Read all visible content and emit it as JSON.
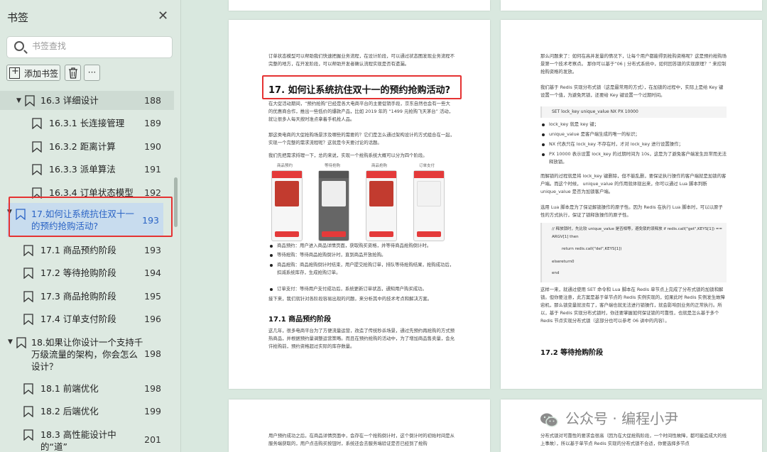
{
  "sidebar": {
    "title": "书签",
    "search_placeholder": "书签查找",
    "add_bookmark_label": "添加书签",
    "more_label": "···",
    "items": [
      {
        "title": "16.3 详细设计",
        "page": "188"
      },
      {
        "title": "16.3.1 长连接管理",
        "page": "189"
      },
      {
        "title": "16.3.2 距离计算",
        "page": "190"
      },
      {
        "title": "16.3.3 派单算法",
        "page": "191"
      },
      {
        "title": "16.3.4 订单状态模型",
        "page": "192"
      },
      {
        "title": "17.如何让系统抗住双十一的预约抢购活动?",
        "page": "193"
      },
      {
        "title": "17.1 商品预约阶段",
        "page": "193"
      },
      {
        "title": "17.2 等待抢购阶段",
        "page": "194"
      },
      {
        "title": "17.3 商品抢购阶段",
        "page": "195"
      },
      {
        "title": "17.4 订单支付阶段",
        "page": "196"
      },
      {
        "title": "18.如果让你设计一个支持千万级流量的架构，你会怎么设计？",
        "page": "198"
      },
      {
        "title": "18.1 前端优化",
        "page": "198"
      },
      {
        "title": "18.2 后端优化",
        "page": "199"
      },
      {
        "title": "18.3 高性能设计中的“道”",
        "page": "201"
      }
    ]
  },
  "doc": {
    "left_heading": "17. 如何让系统抗住双十一的预约抢购活动?",
    "left_sub_heading": "17.1 商品预约阶段",
    "right_sub_heading": "17.2 等待抢购阶段",
    "left_intro": "订单状态模型可以帮助我们快速把握业务流程，在设计阶段，可以通过状态图发现业务流程不完整的地方，在开发阶段，可以帮助开发者确认流程实现是否有遗漏。",
    "left_para1": "在大促活动期间，“预约抢购”已经是各大电商平台的主要促销手段，京东自然也会有一些大的优惠商合作，推出一些低价的爆款产品，比如 2019 年的 “1499 元抢购飞天茅台” 活动，就让很多人每天按时准点拿着手机抢人品。",
    "left_para2": "那这类电商的大促抢购场景涉及哪些的需要的？它们是怎么通过架构设计的方式组合在一起，实现一个完整的需求流程呢？这就是今天要讨论的话题。",
    "left_para3": "我们先把需求捋理一下，总的来说，实现一个抢购系统大概可以分为四个阶段。",
    "phone_labels": [
      "商品预约",
      "等待抢购",
      "商品抢购",
      "订单支付"
    ],
    "left_bullets": [
      "商品预约：用户进入商品详情页面，获取购买资格，并等待商品抢购倒计时。",
      "等待抢购：等待商品抢购倒计时，直到商品开放抢购。",
      "商品抢购：商品抢购倒计时结束，用户提交抢购订单，排队等待抢购结果，抢购成功后，扣减系统库存，生成抢购订单。",
      "订单支付：等待用户支付成功后，系统更新订单状态，通知用户购买成功。"
    ],
    "left_para4": "接下来，我们就针对各阶段容易出现的问题，来分析其中的技术考点和解决方案。",
    "left_para5": "这几年，很多电商平台为了方便流量运营，改造了传统秒杀场景，通过先预约再抢购的方式预热商品，并根据预约量调整运营策略。而且在预约抢购的活动中，为了增加商品售卖量，会允许抢购前，预约资格超过实际的库存数量。",
    "right_para1": "那么问题来了：如何在高并发量的情况下，让每个用户都能得到抢购资格呢？这是预约抢购场景第一个技术考察点。 那你可以基于“06 | 分布式系统中，如何回答锁的实现原理？” 来控制抢购资格的发放。",
    "right_para2": "我们基于 Redis 实现分布式锁（这是最常用的方式），在加锁的过程中，实际上是给 Key 键设置一个值，为避免死锁，还要给 Key 键设置一个过期时间。",
    "right_code1": "SET lock_key unique_value NX PX 10000",
    "right_bullets": [
      "lock_key 就是 key 键；",
      "unique_value 是客户端生成的唯一的标识；",
      "NX 代表只在 lock_key 不存在时，才对 lock_key 进行设置操作；",
      "PX 10000 表示设置 lock_key 的过期时间为 10s，这是为了避免客户端发生异常而无法释放锁。"
    ],
    "right_para3": "而解锁的过程就是将 lock_key 键删除，但不能乱删，要保证执行操作的客户端就是加锁的客户端。而这个时候， unique_value 的作用就体现出来，你可以通过 Lua 脚本判断 unique_value 是否为加锁客户端。",
    "right_para4": "选用 Lua 脚本是为了保证解锁操作的原子性。因为 Redis 在执行 Lua 脚本时，可以以原子性的方式执行，保证了锁释放操作的原子性。",
    "right_code2": [
      "// 释放锁时，先比较 unique_value 是否相等，避免锁的误释放 if redis.call(\"get\",KEYS[1]) == ARGV[1] then",
      "return redis.call(\"del\",KEYS[1])",
      "elsereturn0",
      "end"
    ],
    "right_para5": "这样一来，就通过使用 SET 命令和 Lua 脚本在 Redis 单节点上完成了分布式锁的加锁和解锁。但你要注意，此方案是基于单节点的 Redis 实例实现的，如果此时 Redis 实例发生故障宕机，那么锁变量就没有了，客户端也就无法进行锁操作，就会影响到业务的正常执行。所以，基于 Redis 实现分布式锁时，你还要掌握如何保证锁的可靠性，也就是怎么基于多个 Redis 节点实现分布式锁（这部分也可以参考 06 讲中的内容）。",
    "bottom_left": "用户预约成功之后，在商品详情页面中，会存在一个抢购倒计时，这个倒计时的初始时间是从服务端获取的，用户点击购买按钮时，系统还会去服务端验证是否已经到了抢购",
    "bottom_right": "分布式锁对可靠性的要求会很高（因为在大促抢购阶段，一个时间性故障，都可能造成大的线上事故），所以基于单节点 Redis 实现的分布式锁不合适，你要选择多节点"
  },
  "watermark": "公众号 · 编程小尹"
}
